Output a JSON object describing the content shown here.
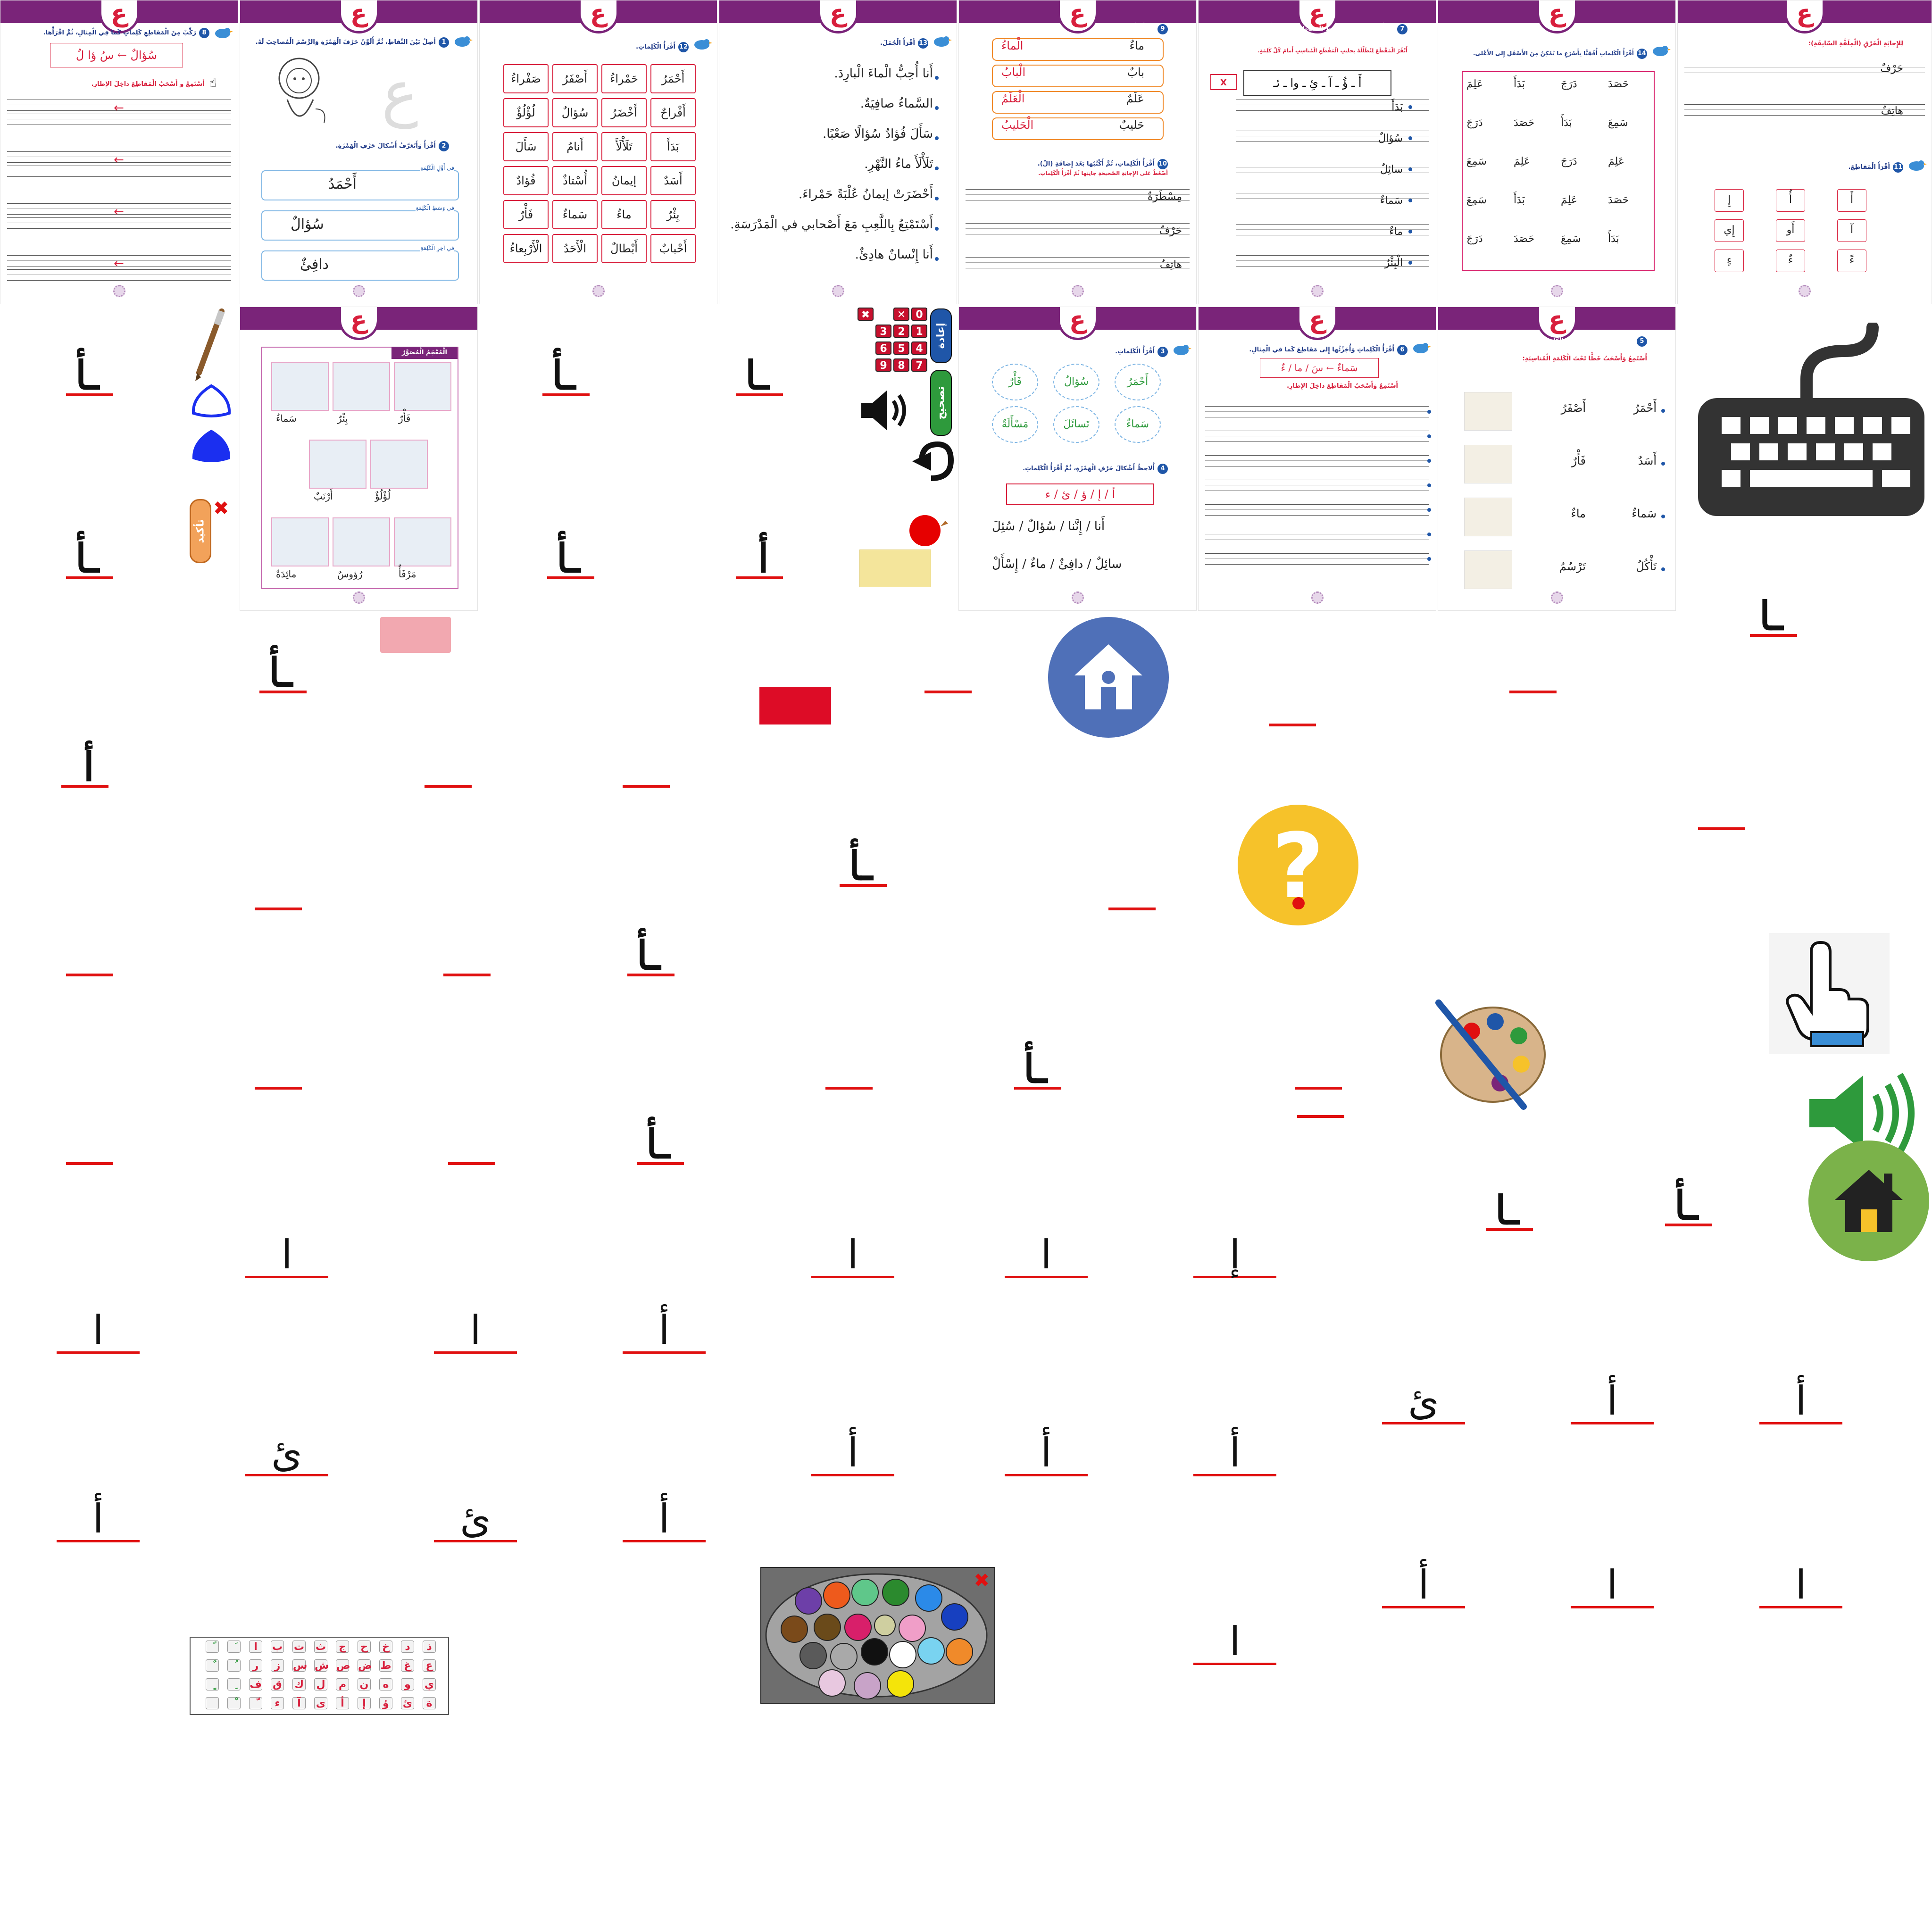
{
  "ain": "ع",
  "pages": {
    "p1": {
      "instr": "رَكِّبْ مِنَ الْمَقاطِعِ كَلِماتٍ كَما فِي الْمِثالِ، ثُمَّ اقْرَأْها.",
      "num": "8",
      "example": "سُؤالٌ ← سُ ؤا لٌ",
      "note": "أَسْتَمِعُ و أَسْحَبُ الْمَقاطِعَ داخِلَ الإِطارِ."
    },
    "p2": {
      "num1": "1",
      "instr1": "أَصِلُ بَيْنَ النِّقاطِ، ثُمَّ أُلَوِّنُ حَرْفَ الْهَمْزَةِ وَالرَّسْمَ الْمُصاحِبَ لَهُ.",
      "num2": "2",
      "instr2": "أَقْرَأُ وَأَتَعَرَّفُ أَشْكالَ حَرْفِ الْهَمْزَةِ.",
      "tag1": "في أَوَّلِ الْكَلِمَةِ",
      "word1": "أَحْمَدُ",
      "tag2": "في وَسَطِ الْكَلِمَةِ",
      "word2": "سُؤالٌ",
      "tag3": "في آخِرِ الْكَلِمَةِ",
      "word3": "دافِئٌ"
    },
    "p3": {
      "num": "12",
      "instr": "أَقْرَأُ الْكَلِماتِ.",
      "words": [
        "أَحْمَرُ",
        "حَمْراءُ",
        "أَصْفَرُ",
        "صَفْراءُ",
        "أَفْراحٌ",
        "أَخْضَرُ",
        "سُؤالٌ",
        "لُؤْلُؤٌ",
        "بَدَأَ",
        "تَلَأْلَأَ",
        "أَنامُ",
        "سَأَلَ",
        "أَسَدٌ",
        "إيمانُ",
        "أُسْتاذٌ",
        "فُؤادٌ",
        "بِئْرٌ",
        "ماءٌ",
        "سَماءٌ",
        "فَأْرٌ",
        "أَحْبابٌ",
        "أَبْطالٌ",
        "الْأَحَدُ",
        "الْأَرْبِعاءُ"
      ]
    },
    "p4": {
      "num": "13",
      "instr": "أَقْرَأُ الْجُمَلَ.",
      "lines": [
        "أَنا أُحِبُّ الْماءَ الْبارِدَ.",
        "السَّماءُ صافِيَةٌ.",
        "سَأَلَ فُؤادٌ سُؤالًا صَعْبًا.",
        "تَلَأْلَأَ ماءُ النَّهْرِ.",
        "أَحْضَرَتْ إيمانُ عُلْبَةً حَمْراءَ.",
        "أَسْتَمْتِعُ بِاللَّعِبِ مَعَ أَصْحابي في الْمَدْرَسَةِ.",
        "أَنا إِنْسانٌ هادِئٌ."
      ]
    },
    "p5": {
      "num1": "9",
      "instr1": "أَقْرَأُ وَأُلاحِظُ (الْ).",
      "pairs": [
        [
          "ماءٌ",
          "الْماءُ"
        ],
        [
          "بابٌ",
          "الْبابُ"
        ],
        [
          "عَلَمٌ",
          "الْعَلَمُ"
        ],
        [
          "حَليبٌ",
          "الْحَليبُ"
        ]
      ],
      "num2": "10",
      "instr2": "أَقْرَأُ الْكَلِماتِ، ثُمَّ أَكْتُبُها بَعْدَ إِضافَةِ (الْ).",
      "note2": "أَضْغَطُ عَلى الإِجابَةِ الصَّحيحَةِ جانِبَها ثُمَّ أَقْرَأُ الْكَلِماتِ.",
      "words": [
        "مِسْطَرَةٌ",
        "حَرْفٌ",
        "هاتِفٌ"
      ]
    },
    "p6": {
      "num": "7",
      "instr": "أَقْرَأُ الْكَلِماتِ، ثُمَّ أَلْتَقِطُ الْمَقاطِعَ الآتِيَةَ بِاللَّوْنِ الأَحْمَرِ كَما في الْمِثالِ.",
      "note": "أَنْقُرُ الْمَقْطَعَ لِتُظَلِّلَهُ بِجانِبِ الْمَقْطَعِ الْمُناسِبِ أَمامَ كُلِّ كَلِمَةٍ.",
      "choices": "أَ ـ ؤُ ـ آ ـ ئِ ـ وا ـ ئـ",
      "words": [
        "بَدَأَ",
        "سُؤالٌ",
        "سائِلٌ",
        "سَماءٌ",
        "ماءٌ",
        "الْبِئْرُ"
      ]
    },
    "p7": {
      "num": "14",
      "instr": "أَقْرَأُ الْكَلِماتِ أُفُقِيًّا بِأَسْرَعِ ما يُمْكِنُ مِنَ الأَسْفَلِ إِلى الأَعْلى.",
      "grid": [
        [
          "حَصَدَ",
          "دَرَجَ",
          "بَدَأَ",
          "عَلِمَ"
        ],
        [
          "سَمِعَ",
          "بَدَأَ",
          "حَصَدَ",
          "دَرَجَ"
        ],
        [
          "عَلِمَ",
          "دَرَجَ",
          "عَلِمَ",
          "سَمِعَ"
        ],
        [
          "حَصَدَ",
          "عَلِمَ",
          "بَدَأَ",
          "سَمِعَ"
        ],
        [
          "بَدَأَ",
          "سَمِعَ",
          "حَصَدَ",
          "دَرَجَ"
        ]
      ]
    },
    "p8": {
      "title": "لِلإِجابَةِ الْخَرْقِ (الْمِلَفَّةِ السّابِقَةِ):",
      "words": [
        "حَرْفٌ",
        "هاتِفٌ"
      ],
      "num": "11",
      "instr": "أَقْرَأُ الْمَقاطِعَ.",
      "cells": [
        "أَ",
        "أُ",
        "إِ",
        "آ",
        "أَو",
        "إِي",
        "ءً",
        "ءٌ",
        "ءٍ"
      ]
    },
    "p9": {
      "title": "الْمُعْجَمُ الْمُصَوَّرُ",
      "items": [
        "سَماءٌ",
        "بِئْرٌ",
        "فَأْرٌ",
        "أَرْنَبٌ",
        "لُؤْلُؤٌ",
        "مائِدَةٌ",
        "رُؤوسٌ",
        "مَرْفَأٌ"
      ]
    },
    "p10": {
      "num1": "3",
      "instr1": "أَقْرَأُ الْكَلِماتِ.",
      "bubbles": [
        "أَحْمَرُ",
        "سُؤالٌ",
        "فَأْرٌ",
        "سَماءٌ",
        "تَسائَلَ",
        "مَسْأَلَةٌ"
      ],
      "num2": "4",
      "instr2": "أُلاحِظُ أَشْكالَ حَرْفِ الْهَمْزَةِ، ثُمَّ أَقْرَأُ الْكَلِماتِ.",
      "forms": "أ / إ / ؤ / ئ / ء",
      "row1": "أَنا / إِنَّنا / سُؤالٌ / سُئِلَ",
      "row2": "سائِلٌ / دافِئٌ / ماءٌ / إِسْأَلْ"
    },
    "p11": {
      "num": "6",
      "instr": "أَقْرَأُ الْكَلِماتِ وَأُجَزِّئُها إِلى مَقاطِعَ كَما في الْمِثالِ.",
      "example": "سَماءٌ ← سَ / ما / ءٌ",
      "note": "أَسْتَمِعُ وَأَسْحَبُ الْمَقاطِعَ داخِلَ الإِطارِ."
    },
    "p12": {
      "num": "5",
      "instr": "أَقْرَأُ، ثُمَّ أَضَعُ خَطًّا تَحْتَ الْكَلِماتِ الَّتي تُعَبِّرُ عَنِ الصّورَةِ.",
      "note": "أَسْتَمِعُ وَأَسْحَبُ خَطًّا تَحْتَ الْكَلِمَةِ الْمُناسِبَةِ:",
      "rows": [
        [
          "أَحْمَرُ",
          "أَصْفَرُ"
        ],
        [
          "أَسَدٌ",
          "فَأْرٌ"
        ],
        [
          "سَماءٌ",
          "ماءٌ"
        ],
        [
          "تَأْكُلُ",
          "تَرْسُمُ"
        ]
      ]
    }
  },
  "toolbar": {
    "redo": "إعادة",
    "check": "تصحيح",
    "confirm": "تأكيد"
  },
  "keypad": [
    "0",
    "✕",
    "✖",
    "1",
    "2",
    "3",
    "4",
    "5",
    "6",
    "7",
    "8",
    "9"
  ],
  "keyboard": [
    [
      "ذ",
      "د",
      "خ",
      "ح",
      "ج",
      "ث",
      "ت",
      "ب",
      "ا",
      "َ",
      "ً"
    ],
    [
      "ع",
      "غ",
      "ط",
      "ض",
      "ص",
      "ش",
      "س",
      "ز",
      "ر",
      "ُ",
      "ٌ"
    ],
    [
      "ي",
      "و",
      "ه",
      "ن",
      "م",
      "ل",
      "ك",
      "ق",
      "ف",
      "ِ",
      "ٍ"
    ],
    [
      "ة",
      "ئ",
      "ؤ",
      "إ",
      "أ",
      "ى",
      "آ",
      "ء",
      "ّ",
      "ْ",
      ""
    ]
  ],
  "seg_letters": [
    "ـأ",
    "ـأ",
    "ـا",
    "ـأ",
    "ـأ",
    "أ",
    "ـأ"
  ],
  "answer_letters": [
    "ا",
    "ا",
    "ا",
    "إ",
    "ا",
    "ا",
    "أ",
    "ئ",
    "أ",
    "أ",
    "ئ",
    "أ",
    "أ",
    "أ",
    "أ",
    "ئ",
    "أ",
    "أ"
  ],
  "colors": {
    "purple": "#7a2479",
    "red": "#e01010",
    "blue": "#1f56a8",
    "yellow": "#f6c22a",
    "homeBlue": "#4f70b8",
    "homeGreen": "#7bb24a",
    "speaker": "#2e9a3c"
  }
}
